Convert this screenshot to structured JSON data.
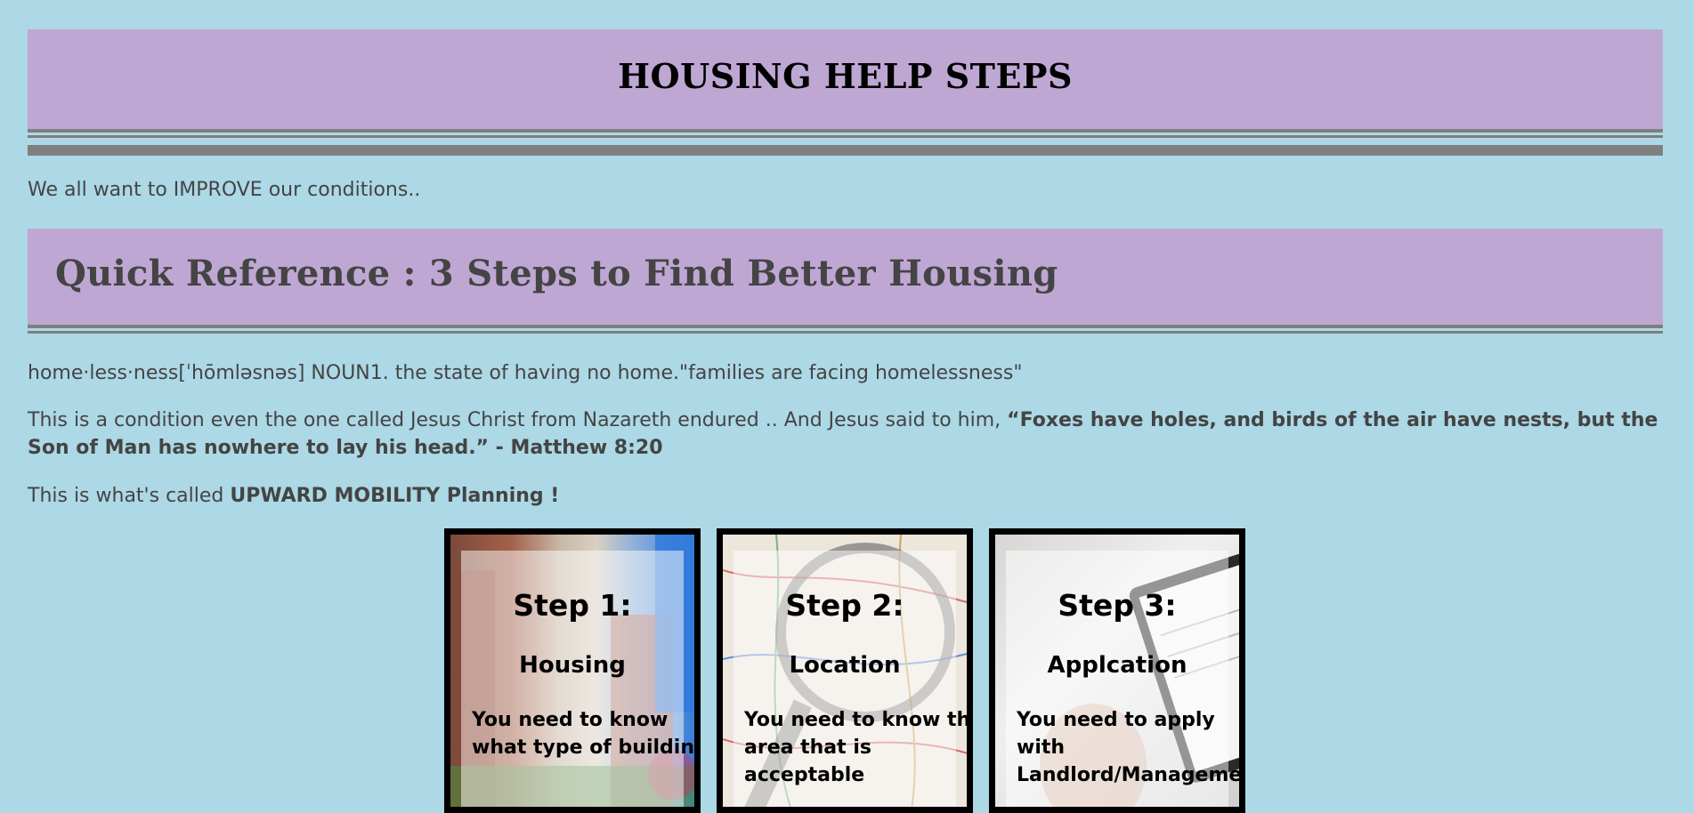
{
  "header": {
    "title": "HOUSING HELP STEPS"
  },
  "intro": "We all want to IMPROVE our conditions..",
  "section": {
    "title": "Quick Reference : 3 Steps to Find Better Housing"
  },
  "definition": "home·less·ness[ˈhōmləsnəs] NOUN1. the state of having no home.\"families are facing homelessness\"",
  "scripture": {
    "lead": "This is a condition even the one called Jesus Christ from Nazareth endured .. And Jesus said to him, ",
    "quote": "“Foxes have holes, and birds of the air have nests, but the Son of Man has nowhere to lay his head.” - Matthew 8:20"
  },
  "mobility": {
    "lead": "This is what's called ",
    "emphasis": "UPWARD MOBILITY Planning !"
  },
  "steps": [
    {
      "step": "Step 1:",
      "title": "Housing",
      "desc": "You need to know what type of building",
      "image": "apartment-street-photo"
    },
    {
      "step": "Step 2:",
      "title": "Location",
      "desc": "You need to know the area that is acceptable",
      "image": "map-magnifier-photo"
    },
    {
      "step": "Step 3:",
      "title": "Applcation",
      "desc": "You need to apply with Landlord/Management",
      "image": "tablet-application-photo"
    }
  ],
  "colors": {
    "background": "#add8e6",
    "banner": "#bfa7d4",
    "rule": "#7f7f7f",
    "text": "#444444"
  }
}
